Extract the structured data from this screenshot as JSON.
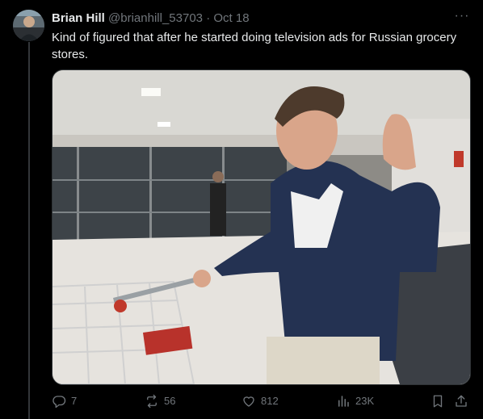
{
  "tweet": {
    "author_name": "Brian Hill",
    "author_handle": "@brianhill_53703",
    "separator": "·",
    "date": "Oct 18",
    "more_label": "···",
    "text": "Kind of figured that after he started doing television ads for Russian grocery stores."
  },
  "actions": {
    "replies": "7",
    "retweets": "56",
    "likes": "812",
    "views": "23K"
  },
  "icons": {
    "reply": "reply-icon",
    "retweet": "retweet-icon",
    "like": "heart-icon",
    "views": "analytics-icon",
    "bookmark": "bookmark-icon",
    "share": "share-icon",
    "more": "more-icon"
  },
  "colors": {
    "background": "#000000",
    "text": "#e7e9ea",
    "muted": "#71767b",
    "border": "#2f3336",
    "thread_line": "#333639"
  }
}
